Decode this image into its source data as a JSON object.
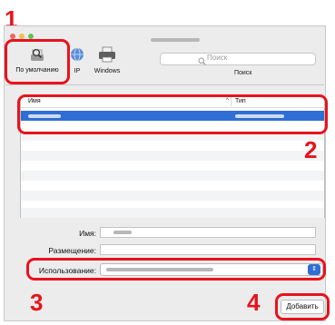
{
  "toolbar": {
    "default_label": "По умолчанию",
    "ip_label": "IP",
    "windows_label": "Windows",
    "search_placeholder": "Поиск",
    "search_caption": "Поиск"
  },
  "table": {
    "col_name": "Имя",
    "col_type": "Тип"
  },
  "form": {
    "name_label": "Имя:",
    "location_label": "Размещение:",
    "use_label": "Использование:"
  },
  "buttons": {
    "add": "Добавить"
  },
  "steps": [
    "1",
    "2",
    "3",
    "4"
  ],
  "colors": {
    "highlight": "#e8131c",
    "selection": "#2f6ed5"
  }
}
